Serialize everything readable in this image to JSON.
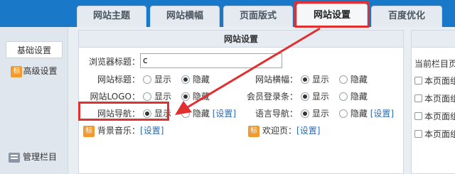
{
  "tabs": [
    {
      "label": "网站主题"
    },
    {
      "label": "网站横幅"
    },
    {
      "label": "页面版式"
    },
    {
      "label": "网站设置"
    },
    {
      "label": "百度优化"
    }
  ],
  "sidebar": {
    "items": [
      {
        "label": "基础设置",
        "badge": ""
      },
      {
        "label": "高级设置",
        "badge": "标"
      }
    ],
    "bottom_label": "管理栏目"
  },
  "panel": {
    "title": "网站设置",
    "browser_title_label": "浏览器标题：",
    "browser_title_value": "c",
    "rows": {
      "site_title": {
        "label": "网站标题：",
        "show": "显示",
        "hide": "隐藏",
        "selected": "hide"
      },
      "site_logo": {
        "label": "网站LOGO：",
        "show": "显示",
        "hide": "隐藏",
        "selected": "hide"
      },
      "site_nav": {
        "label": "网站导航：",
        "show": "显示",
        "hide": "隐藏",
        "selected": "show",
        "link": "[设置]"
      },
      "site_banner": {
        "label": "网站横幅：",
        "show": "显示",
        "hide": "隐藏",
        "selected": "show"
      },
      "member_bar": {
        "label": "会员登录条：",
        "show": "显示",
        "hide": "隐藏",
        "selected": "show"
      },
      "lang_nav": {
        "label": "语言导航：",
        "show": "显示",
        "hide": "隐藏",
        "selected": "show",
        "link": "[设置]"
      }
    },
    "bg_music": {
      "badge": "标",
      "label": "背景音乐：",
      "link": "[设置]"
    },
    "welcome": {
      "badge": "标",
      "label": "欢迎页：",
      "link": "[设置]"
    }
  },
  "right_panel": {
    "label": "当前栏目页",
    "items": [
      "本页面组",
      "本页面组",
      "本页面组",
      "本页面组"
    ]
  },
  "colors": {
    "topbar": "#1a78c8",
    "highlight": "#e03030",
    "badge": "#f29a2e",
    "link": "#2b6cb0"
  }
}
